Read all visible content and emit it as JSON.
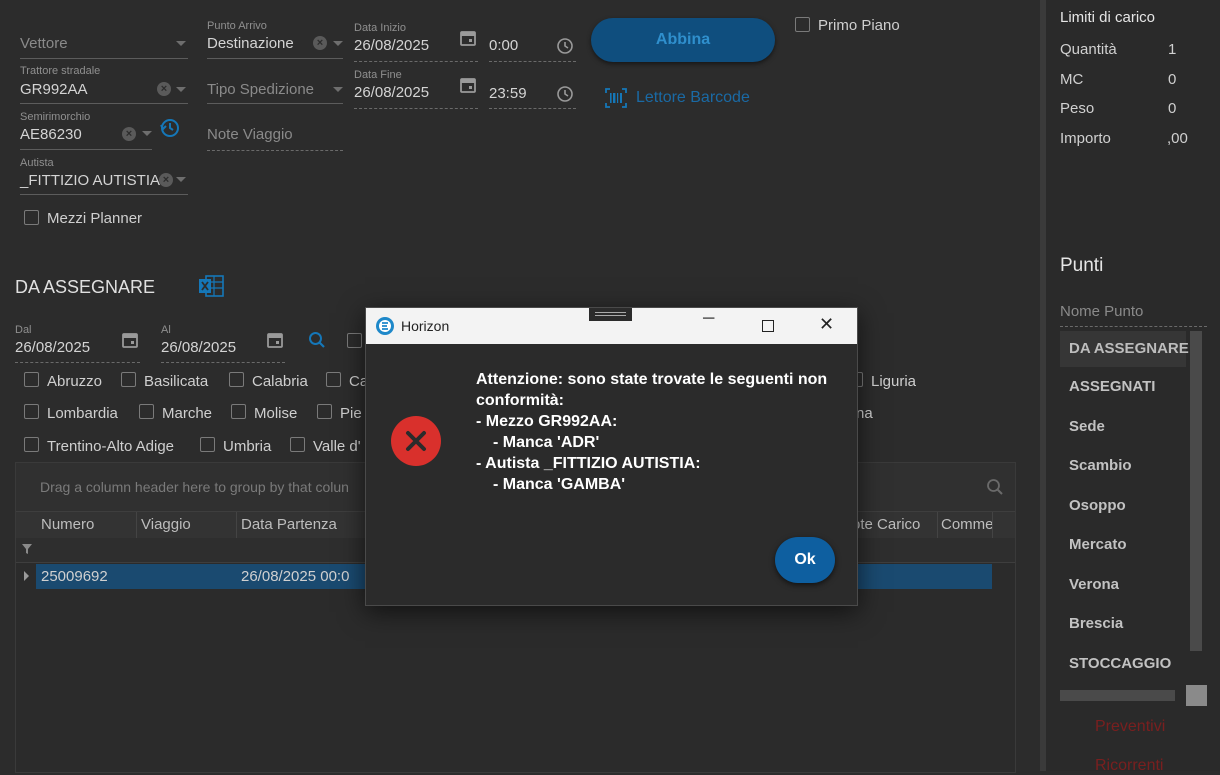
{
  "form": {
    "vettore_placeholder": "Vettore",
    "trattore_label": "Trattore stradale",
    "trattore_value": "GR992AA",
    "semirimorchio_label": "Semirimorchio",
    "semirimorchio_value": "AE86230",
    "autista_label": "Autista",
    "autista_value": "_FITTIZIO AUTISTIA",
    "mezzi_planner_label": "Mezzi Planner",
    "punto_arrivo_label": "Punto Arrivo",
    "punto_arrivo_value": "Destinazione",
    "tipo_spedizione_placeholder": "Tipo Spedizione",
    "note_viaggio_placeholder": "Note Viaggio",
    "data_inizio_label": "Data Inizio",
    "data_inizio_value": "26/08/2025",
    "ora_inizio_value": "0:00",
    "data_fine_label": "Data Fine",
    "data_fine_value": "26/08/2025",
    "ora_fine_value": "23:59",
    "abbina_label": "Abbina",
    "lettore_barcode_label": "Lettore Barcode",
    "primo_piano_label": "Primo Piano"
  },
  "da_assegnare": {
    "title": "DA ASSEGNARE",
    "dal_label": "Dal",
    "dal_value": "26/08/2025",
    "al_label": "Al",
    "al_value": "26/08/2025",
    "regions_row1": [
      "Abruzzo",
      "Basilicata",
      "Calabria",
      "Ca",
      "Liguria"
    ],
    "regions_row2": [
      "Lombardia",
      "Marche",
      "Molise",
      "Pie",
      "na"
    ],
    "regions_row3": [
      "Trentino-Alto Adige",
      "Umbria",
      "Valle d'"
    ]
  },
  "grid": {
    "group_hint": "Drag a column header here to group by that colun",
    "columns": [
      "Numero",
      "Viaggio",
      "Data Partenza",
      "ote Carico",
      "Comme"
    ],
    "row": {
      "numero": "25009692",
      "viaggio": "",
      "data_partenza": "26/08/2025 00:0"
    }
  },
  "limiti": {
    "title": "Limiti di carico",
    "rows": [
      {
        "label": "Quantità",
        "value": "1"
      },
      {
        "label": "MC",
        "value": "0"
      },
      {
        "label": "Peso",
        "value": "0"
      },
      {
        "label": "Importo",
        "value": ",00"
      }
    ]
  },
  "punti": {
    "title": "Punti",
    "search_placeholder": "Nome Punto",
    "items": [
      "DA ASSEGNARE",
      "ASSEGNATI",
      "Sede",
      "Scambio",
      "Osoppo",
      "Mercato",
      "Verona",
      "Brescia",
      "STOCCAGGIO"
    ],
    "link1": "Preventivi",
    "link2": "Ricorrenti"
  },
  "dialog": {
    "title": "Horizon",
    "line1": "Attenzione: sono state trovate le seguenti non",
    "line2": "conformità:",
    "line3": "- Mezzo GR992AA:",
    "line4": "- Manca 'ADR'",
    "line5": "- Autista _FITTIZIO AUTISTIA:",
    "line6": "- Manca 'GAMBA'",
    "ok_label": "Ok"
  },
  "colors": {
    "accent": "#1577b8",
    "error": "#d9302c",
    "selected_row": "#1a4a70"
  }
}
